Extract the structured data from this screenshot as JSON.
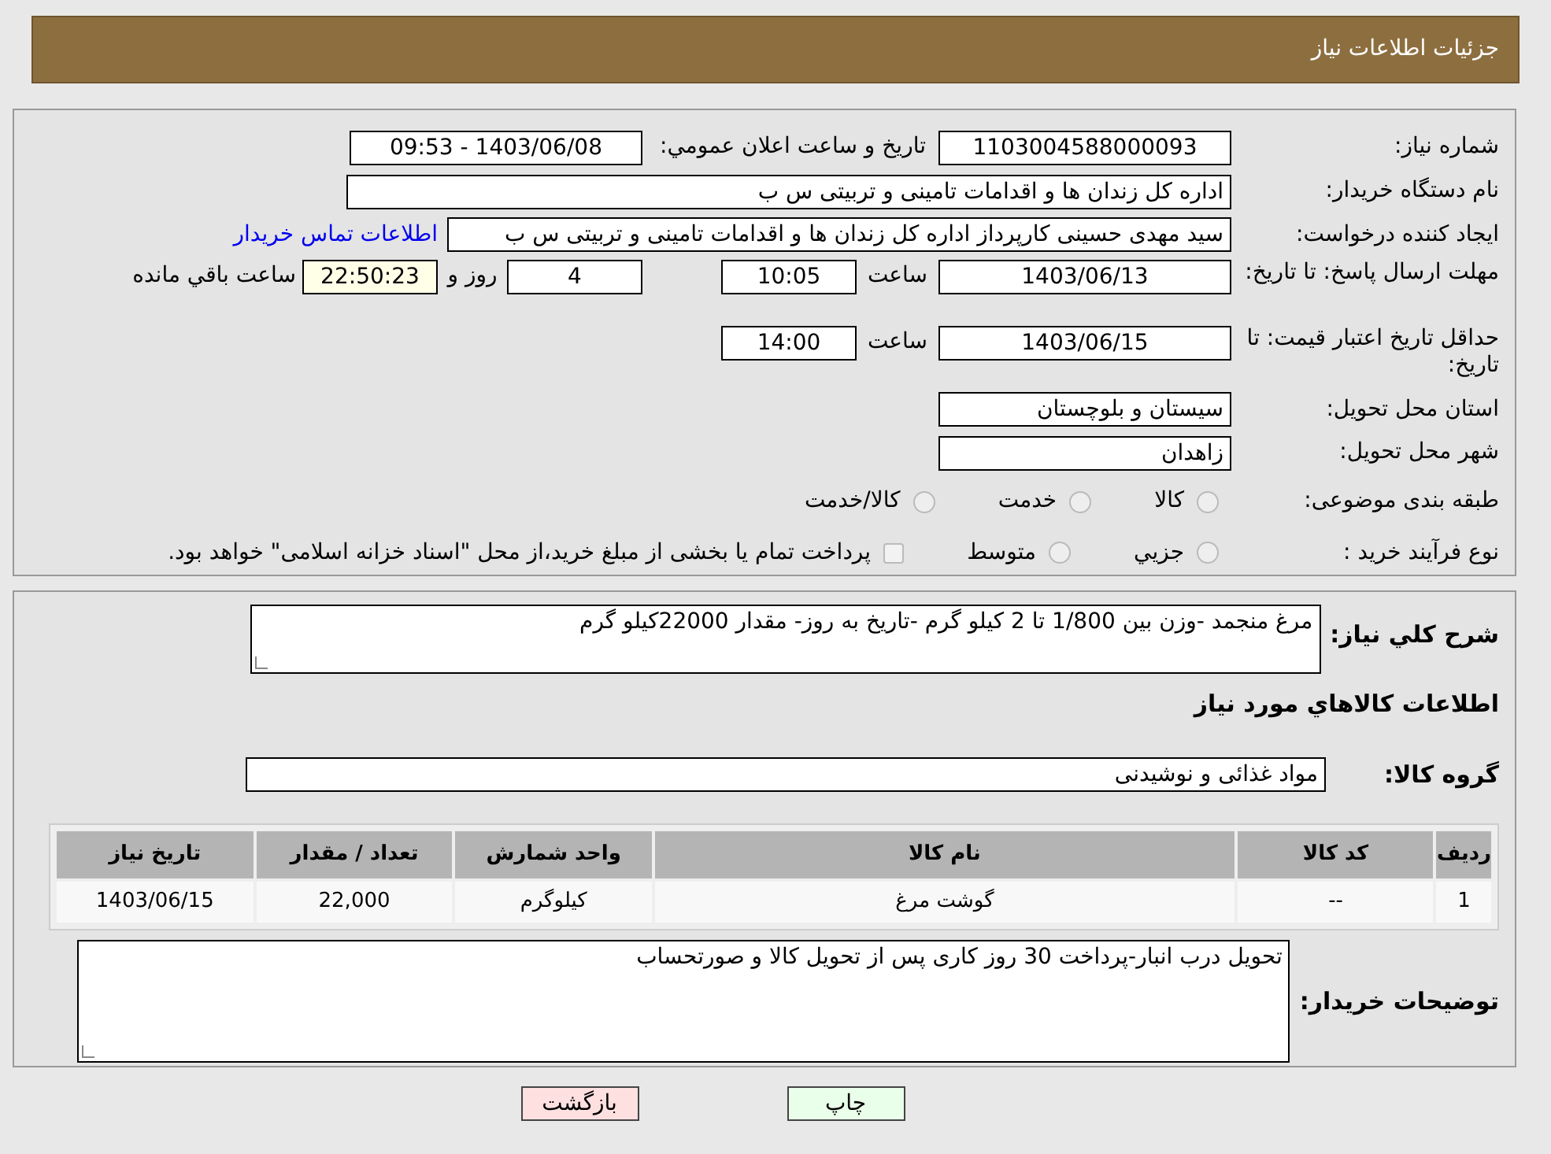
{
  "header": {
    "title": "جزئیات اطلاعات نیاز"
  },
  "need_number": {
    "label": "شماره نیاز:",
    "value": "1103004588000093"
  },
  "announce": {
    "label": "تاریخ و ساعت اعلان عمومي:",
    "value": "1403/06/08 - 09:53"
  },
  "buyer_org": {
    "label": "نام دستگاه خریدار:",
    "value": "اداره کل زندان ها و اقدامات تامینی و تربیتی س ب"
  },
  "requester": {
    "label": "ایجاد کننده درخواست:",
    "value": "سید مهدی حسینی کارپرداز اداره کل زندان ها و اقدامات تامینی و تربیتی س ب",
    "link": "اطلاعات تماس خریدار"
  },
  "reply_deadline": {
    "label": "مهلت ارسال پاسخ: تا تاریخ:",
    "date": "1403/06/13",
    "time_label": "ساعت",
    "time": "10:05",
    "days": "4",
    "days_label": "روز و",
    "remaining": "22:50:23",
    "remaining_label": "ساعت باقي مانده"
  },
  "price_validity": {
    "label": "حداقل تاریخ اعتبار قیمت: تا تاریخ:",
    "date": "1403/06/15",
    "time_label": "ساعت",
    "time": "14:00"
  },
  "province": {
    "label": "استان محل تحویل:",
    "value": "سیستان و بلوچستان"
  },
  "city": {
    "label": "شهر محل تحویل:",
    "value": "زاهدان"
  },
  "category": {
    "label": "طبقه بندی موضوعی:",
    "options": [
      {
        "label": "کالا",
        "selected": false
      },
      {
        "label": "خدمت",
        "selected": false
      },
      {
        "label": "کالا/خدمت",
        "selected": false
      }
    ]
  },
  "process": {
    "label": "نوع فرآیند خرید :",
    "options": [
      {
        "label": "جزيي",
        "selected": false
      },
      {
        "label": "متوسط",
        "selected": false
      }
    ],
    "payment": {
      "checked": false,
      "label": "پرداخت تمام یا بخشی از مبلغ خرید،از محل \"اسناد خزانه اسلامی\" خواهد بود."
    }
  },
  "description": {
    "label": "شرح کلي نياز:",
    "value": "مرغ منجمد -وزن بین 1/800 تا 2 کیلو گرم -تاریخ به روز- مقدار 22000کیلو گرم"
  },
  "goods_heading": "اطلاعات کالاهاي مورد نياز",
  "goods_group": {
    "label": "گروه کالا:",
    "value": "مواد غذائی و نوشیدنی"
  },
  "table": {
    "columns": [
      "رديف",
      "کد کالا",
      "نام کالا",
      "واحد شمارش",
      "تعداد / مقدار",
      "تاريخ نياز"
    ],
    "rows": [
      [
        "1",
        "--",
        "گوشت مرغ",
        "کیلوگرم",
        "22,000",
        "1403/06/15"
      ]
    ]
  },
  "buyer_notes": {
    "label": "توضیحات خریدار:",
    "value": "تحویل درب انبار-پرداخت 30 روز کاری پس از تحویل کالا و صورتحساب"
  },
  "buttons": [
    {
      "label": "چاپ",
      "kind": "print"
    },
    {
      "label": "بازگشت",
      "kind": "back"
    }
  ]
}
